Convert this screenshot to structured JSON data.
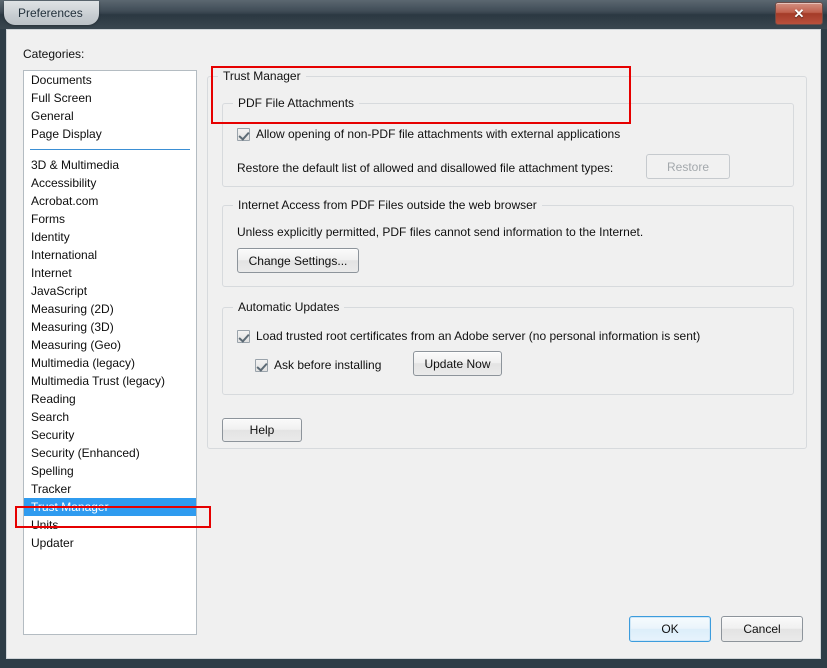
{
  "window": {
    "title": "Preferences",
    "close_label": "✕",
    "close_icon": "close-icon"
  },
  "sidebar": {
    "label": "Categories:",
    "items": [
      {
        "label": "Documents",
        "type": "item",
        "selected": false
      },
      {
        "label": "Full Screen",
        "type": "item",
        "selected": false
      },
      {
        "label": "General",
        "type": "item",
        "selected": false
      },
      {
        "label": "Page Display",
        "type": "item",
        "selected": false
      },
      {
        "label": "",
        "type": "separator",
        "selected": false
      },
      {
        "label": "3D & Multimedia",
        "type": "item",
        "selected": false
      },
      {
        "label": "Accessibility",
        "type": "item",
        "selected": false
      },
      {
        "label": "Acrobat.com",
        "type": "item",
        "selected": false
      },
      {
        "label": "Forms",
        "type": "item",
        "selected": false
      },
      {
        "label": "Identity",
        "type": "item",
        "selected": false
      },
      {
        "label": "International",
        "type": "item",
        "selected": false
      },
      {
        "label": "Internet",
        "type": "item",
        "selected": false
      },
      {
        "label": "JavaScript",
        "type": "item",
        "selected": false
      },
      {
        "label": "Measuring (2D)",
        "type": "item",
        "selected": false
      },
      {
        "label": "Measuring (3D)",
        "type": "item",
        "selected": false
      },
      {
        "label": "Measuring (Geo)",
        "type": "item",
        "selected": false
      },
      {
        "label": "Multimedia (legacy)",
        "type": "item",
        "selected": false
      },
      {
        "label": "Multimedia Trust (legacy)",
        "type": "item",
        "selected": false
      },
      {
        "label": "Reading",
        "type": "item",
        "selected": false
      },
      {
        "label": "Search",
        "type": "item",
        "selected": false
      },
      {
        "label": "Security",
        "type": "item",
        "selected": false
      },
      {
        "label": "Security (Enhanced)",
        "type": "item",
        "selected": false
      },
      {
        "label": "Spelling",
        "type": "item",
        "selected": false
      },
      {
        "label": "Tracker",
        "type": "item",
        "selected": false
      },
      {
        "label": "Trust Manager",
        "type": "item",
        "selected": true
      },
      {
        "label": "Units",
        "type": "item",
        "selected": false
      },
      {
        "label": "Updater",
        "type": "item",
        "selected": false
      }
    ]
  },
  "panel": {
    "title": "Trust Manager",
    "pdf_attachments": {
      "title": "PDF File Attachments",
      "allow_checkbox_label": "Allow opening of non-PDF file attachments with external applications",
      "allow_checkbox_checked": true,
      "restore_text": "Restore the default list of allowed and disallowed file attachment types:",
      "restore_button_label": "Restore",
      "restore_button_disabled": true
    },
    "internet_access": {
      "title": "Internet Access from PDF Files outside the web browser",
      "description": "Unless explicitly permitted, PDF files cannot send information to the Internet.",
      "change_settings_label": "Change Settings..."
    },
    "automatic_updates": {
      "title": "Automatic Updates",
      "load_certs_label": "Load trusted root certificates from an Adobe server (no personal information is sent)",
      "load_certs_checked": true,
      "ask_before_installing_label": "Ask before installing",
      "ask_before_installing_checked": true,
      "update_now_label": "Update Now"
    },
    "help_button_label": "Help"
  },
  "footer": {
    "ok_label": "OK",
    "cancel_label": "Cancel"
  },
  "annotations": {
    "color": "#e60000",
    "boxes": [
      {
        "name": "pdf-file-attachments-highlight"
      },
      {
        "name": "trust-manager-category-highlight"
      }
    ]
  }
}
